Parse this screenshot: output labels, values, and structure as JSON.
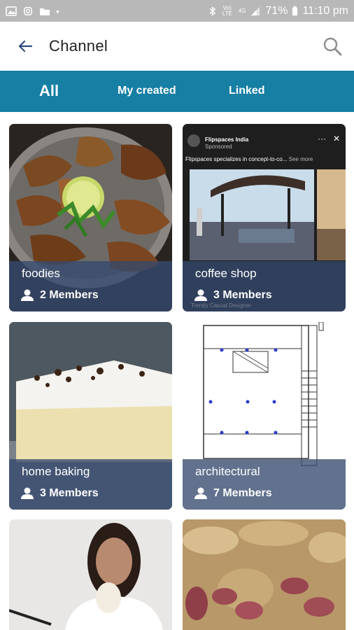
{
  "status": {
    "volte": "Vo) LTE",
    "network": "4G",
    "battery": "71%",
    "time": "11:10 pm"
  },
  "header": {
    "title": "Channel"
  },
  "tabs": [
    {
      "label": "All",
      "active": true
    },
    {
      "label": "My created",
      "active": false
    },
    {
      "label": "Linked",
      "active": false
    }
  ],
  "channels": [
    {
      "name": "foodies",
      "members": "2 Members"
    },
    {
      "name": "coffee shop",
      "members": "3 Members"
    },
    {
      "name": "home baking",
      "members": "3 Members"
    },
    {
      "name": "architectural",
      "members": "7 Members"
    },
    {
      "name": "",
      "members": ""
    },
    {
      "name": "",
      "members": ""
    }
  ],
  "ad": {
    "brand": "Flipspaces India",
    "sponsored": "Sponsored",
    "text": "Flipspaces specializes in concept-to-co...",
    "see_more": "See more",
    "subtext": "Trendy Casual Designer"
  },
  "colors": {
    "tab_bar": "#167fa3",
    "overlay": "#34496e",
    "status_bar": "#b8b8b8"
  }
}
